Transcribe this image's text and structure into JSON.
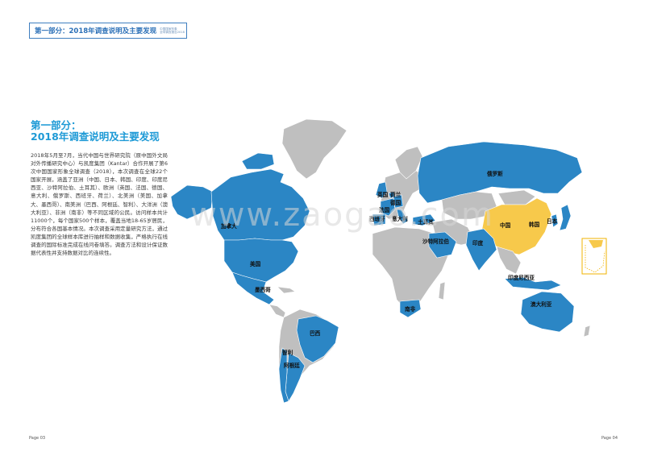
{
  "header": {
    "title": "第一部分：2018年调查说明及主要发现",
    "sub_line1": "中国国家形象",
    "sub_line2": "全球调查报告2018"
  },
  "section": {
    "title_line1": "第一部分：",
    "title_line2": "2018年调查说明及主要发现",
    "body": "2018年5月至7月，当代中国与世界研究院（原中国外文局对外传播研究中心）与凯度集团（Kantar）合作开展了第6次中国国家形象全球调查（2018），本次调查在全球22个国家开展，涵盖了亚洲（中国、日本、韩国、印度、印度尼西亚、沙特阿拉伯、土耳其）、欧洲（英国、法国、德国、意大利、俄罗斯、西班牙、荷兰）、北美洲（美国、加拿大、墨西哥）、南美洲（巴西、阿根廷、智利）、大洋洲（澳大利亚）、非洲（南非）等不同区域的公民。访问样本共计11000个，每个国家500个样本，覆盖当地18-65岁居民，分布符合各国基本情况。本次调查采用定量研究方法，通过凯度集团的全球样本库进行抽样和数据收集，严格执行在线调查的国际标准完成在线问卷填答。调查方法和设计保证数据代表性并支持数据对比的连续性。"
  },
  "watermark": "www.zaogao.com",
  "map": {
    "colors": {
      "ocean": "#ffffff",
      "land": "#bfbfbf",
      "surveyed": "#2b86c5",
      "china": "#f7c94b",
      "border": "#ffffff"
    },
    "country_labels": {
      "canada": "加拿大",
      "usa": "美国",
      "mexico": "墨西哥",
      "brazil": "巴西",
      "chile": "智利",
      "argentina": "阿根廷",
      "uk": "英国",
      "netherlands": "荷兰",
      "germany": "德国",
      "france": "法国",
      "spain": "西班牙",
      "italy": "意大利",
      "turkey": "土耳其",
      "saudi": "沙特阿拉伯",
      "south_africa": "南非",
      "russia": "俄罗斯",
      "china": "中国",
      "korea": "韩国",
      "japan": "日本",
      "india": "印度",
      "indonesia": "印度尼西亚",
      "australia": "澳大利亚"
    }
  },
  "pages": {
    "left": "Page 03",
    "right": "Page 04"
  }
}
